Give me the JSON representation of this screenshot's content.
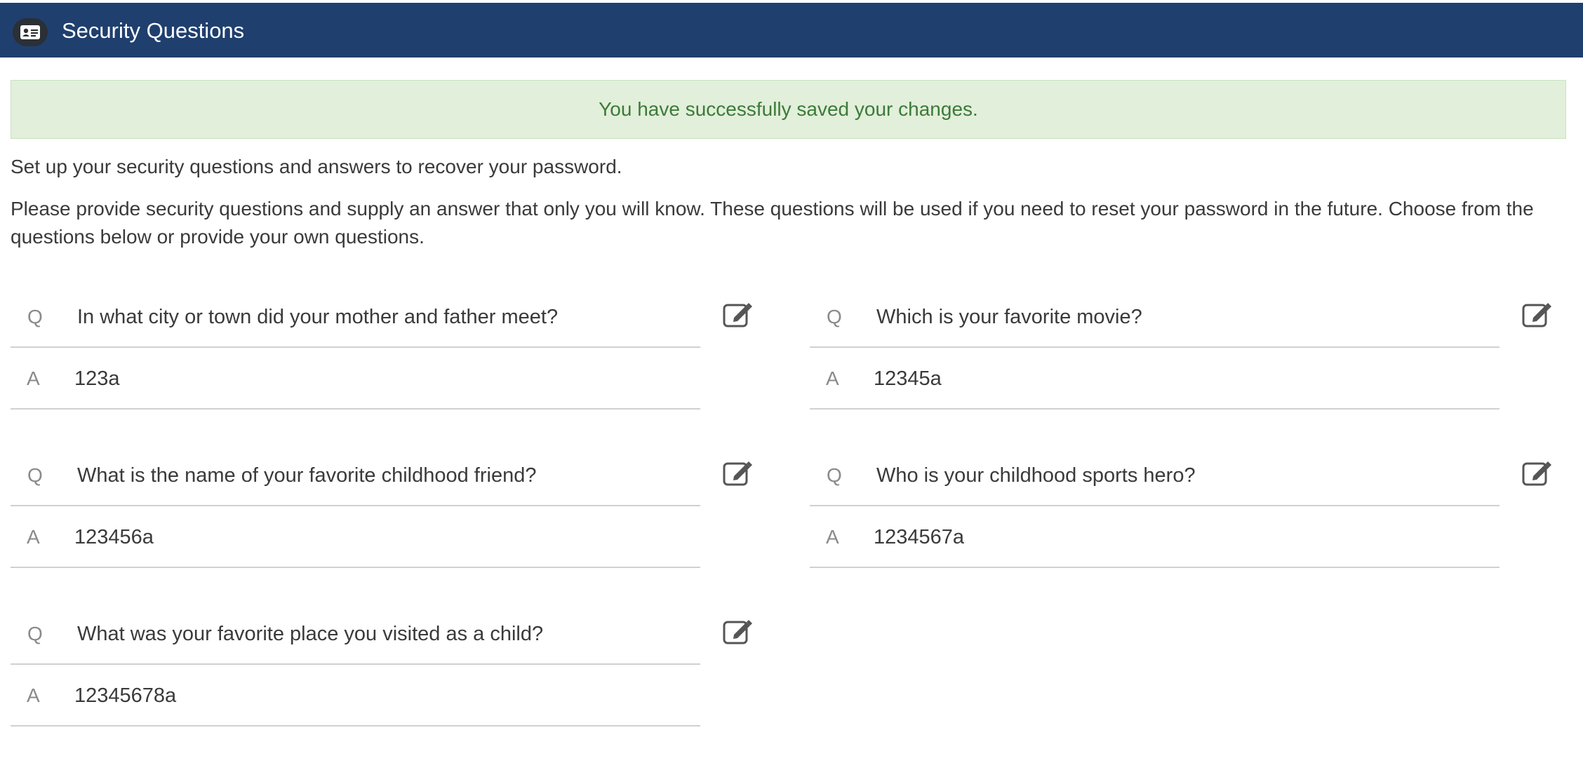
{
  "header": {
    "title": "Security Questions",
    "icon": "id-card-icon"
  },
  "alert": {
    "message": "You have successfully saved your changes.",
    "color": "#3c7a3a"
  },
  "intro": {
    "line1": "Set up your security questions and answers to recover your password.",
    "line2": "Please provide security questions and supply an answer that only you will know. These questions will be used if you need to reset your password in the future. Choose from the questions below or provide your own questions."
  },
  "labels": {
    "q_prefix": "Q",
    "a_prefix": "A"
  },
  "questions": [
    {
      "question": "In what city or town did your mother and father meet?",
      "answer": "123a"
    },
    {
      "question": "Which is your favorite movie?",
      "answer": "12345a"
    },
    {
      "question": "What is the name of your favorite childhood friend?",
      "answer": "123456a"
    },
    {
      "question": "Who is your childhood sports hero?",
      "answer": "1234567a"
    },
    {
      "question": "What was your favorite place you visited as a child?",
      "answer": "12345678a"
    }
  ]
}
